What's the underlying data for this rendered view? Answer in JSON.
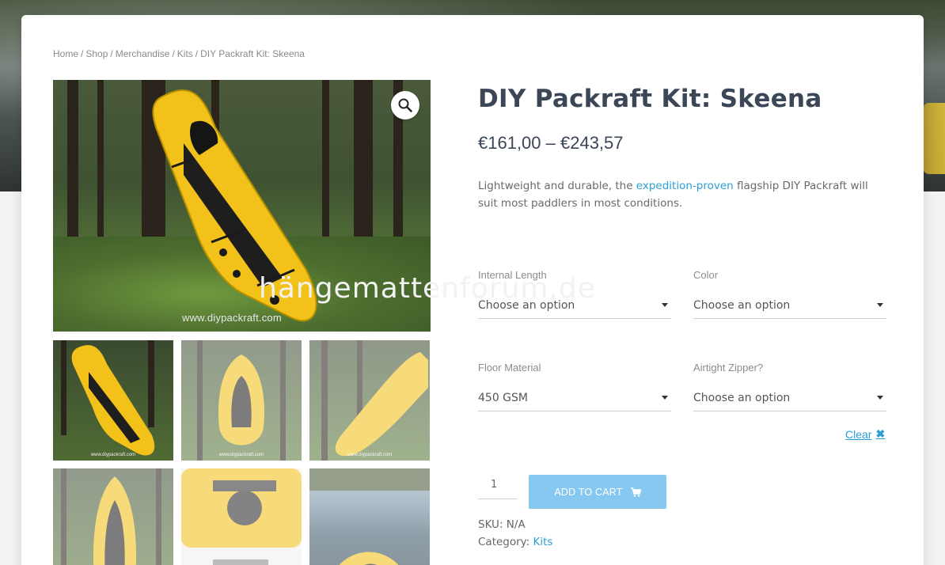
{
  "breadcrumb": {
    "items": [
      "Home",
      "Shop",
      "Merchandise",
      "Kits"
    ],
    "current": "DIY Packraft Kit: Skeena",
    "separator": "/"
  },
  "gallery": {
    "main_watermark": "www.diypackraft.com",
    "thumb_watermark": "www.diypackraft.com",
    "zoom_icon": "magnifier-icon"
  },
  "product": {
    "title": "DIY Packraft Kit: Skeena",
    "price": "€161,00 – €243,57",
    "desc_before": "Lightweight and durable, the ",
    "desc_link": "expedition-proven",
    "desc_after": " flagship DIY Packraft will suit most paddlers in most conditions."
  },
  "overlay_watermark": "hängemattenforum.de",
  "options": {
    "internal_length": {
      "label": "Internal Length",
      "value": "Choose an option"
    },
    "color": {
      "label": "Color",
      "value": "Choose an option"
    },
    "floor_material": {
      "label": "Floor Material",
      "value": "450 GSM"
    },
    "airtight_zipper": {
      "label": "Airtight Zipper?",
      "value": "Choose an option"
    },
    "clear_label": "Clear"
  },
  "cart": {
    "quantity": "1",
    "add_label": "ADD TO CART",
    "cart_icon": "cart-icon"
  },
  "meta": {
    "sku_label": "SKU:",
    "sku_value": "N/A",
    "category_label": "Category:",
    "category_value": "Kits"
  },
  "colors": {
    "accent": "#2b9fd6",
    "button": "#86c8ef",
    "title": "#3b4656",
    "raft_yellow": "#f2c21a"
  }
}
